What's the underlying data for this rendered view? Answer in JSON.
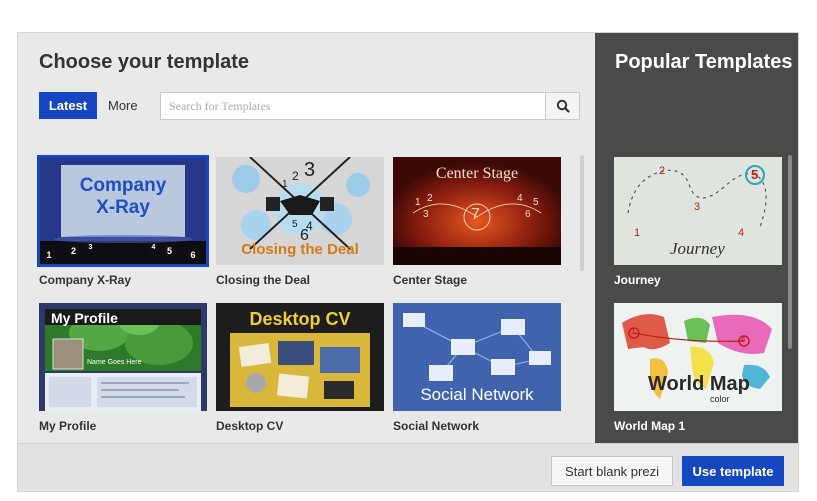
{
  "dialog": {
    "title": "Choose your template",
    "tabs": {
      "latest": "Latest",
      "more": "More"
    },
    "search": {
      "placeholder": "Search for Templates",
      "value": ""
    }
  },
  "templates": [
    {
      "label": "Company X-Ray",
      "selected": true,
      "thumb": {
        "line1": "Company",
        "line2": "X-Ray",
        "nums": [
          "1",
          "2",
          "3",
          "4",
          "5",
          "6"
        ]
      }
    },
    {
      "label": "Closing the Deal",
      "thumb": {
        "caption": "Closing the Deal",
        "nums": [
          "1",
          "2",
          "3",
          "4",
          "5",
          "6"
        ]
      }
    },
    {
      "label": "Center Stage",
      "thumb": {
        "caption": "Center Stage",
        "nums": [
          "1",
          "2",
          "3",
          "4",
          "5",
          "6",
          "7"
        ]
      }
    },
    {
      "label": "My Profile",
      "thumb": {
        "heading": "My Profile",
        "name": "Name Goes Here"
      }
    },
    {
      "label": "Desktop CV",
      "thumb": {
        "heading": "Desktop CV"
      }
    },
    {
      "label": "Social Network",
      "thumb": {
        "caption": "Social Network"
      }
    }
  ],
  "popular": {
    "title": "Popular Templates",
    "items": [
      {
        "label": "Journey",
        "thumb": {
          "caption": "Journey",
          "nums": [
            "1",
            "2",
            "3",
            "4",
            "5"
          ]
        }
      },
      {
        "label": "World Map 1",
        "thumb": {
          "caption": "World Map",
          "sub": "color",
          "nums": [
            "1",
            "4"
          ]
        }
      }
    ]
  },
  "footer": {
    "blank_label": "Start blank prezi",
    "use_label": "Use template"
  },
  "colors": {
    "accent": "#1447c0",
    "side_panel": "#4a4a4a",
    "dialog_bg": "#e9e9e9"
  }
}
